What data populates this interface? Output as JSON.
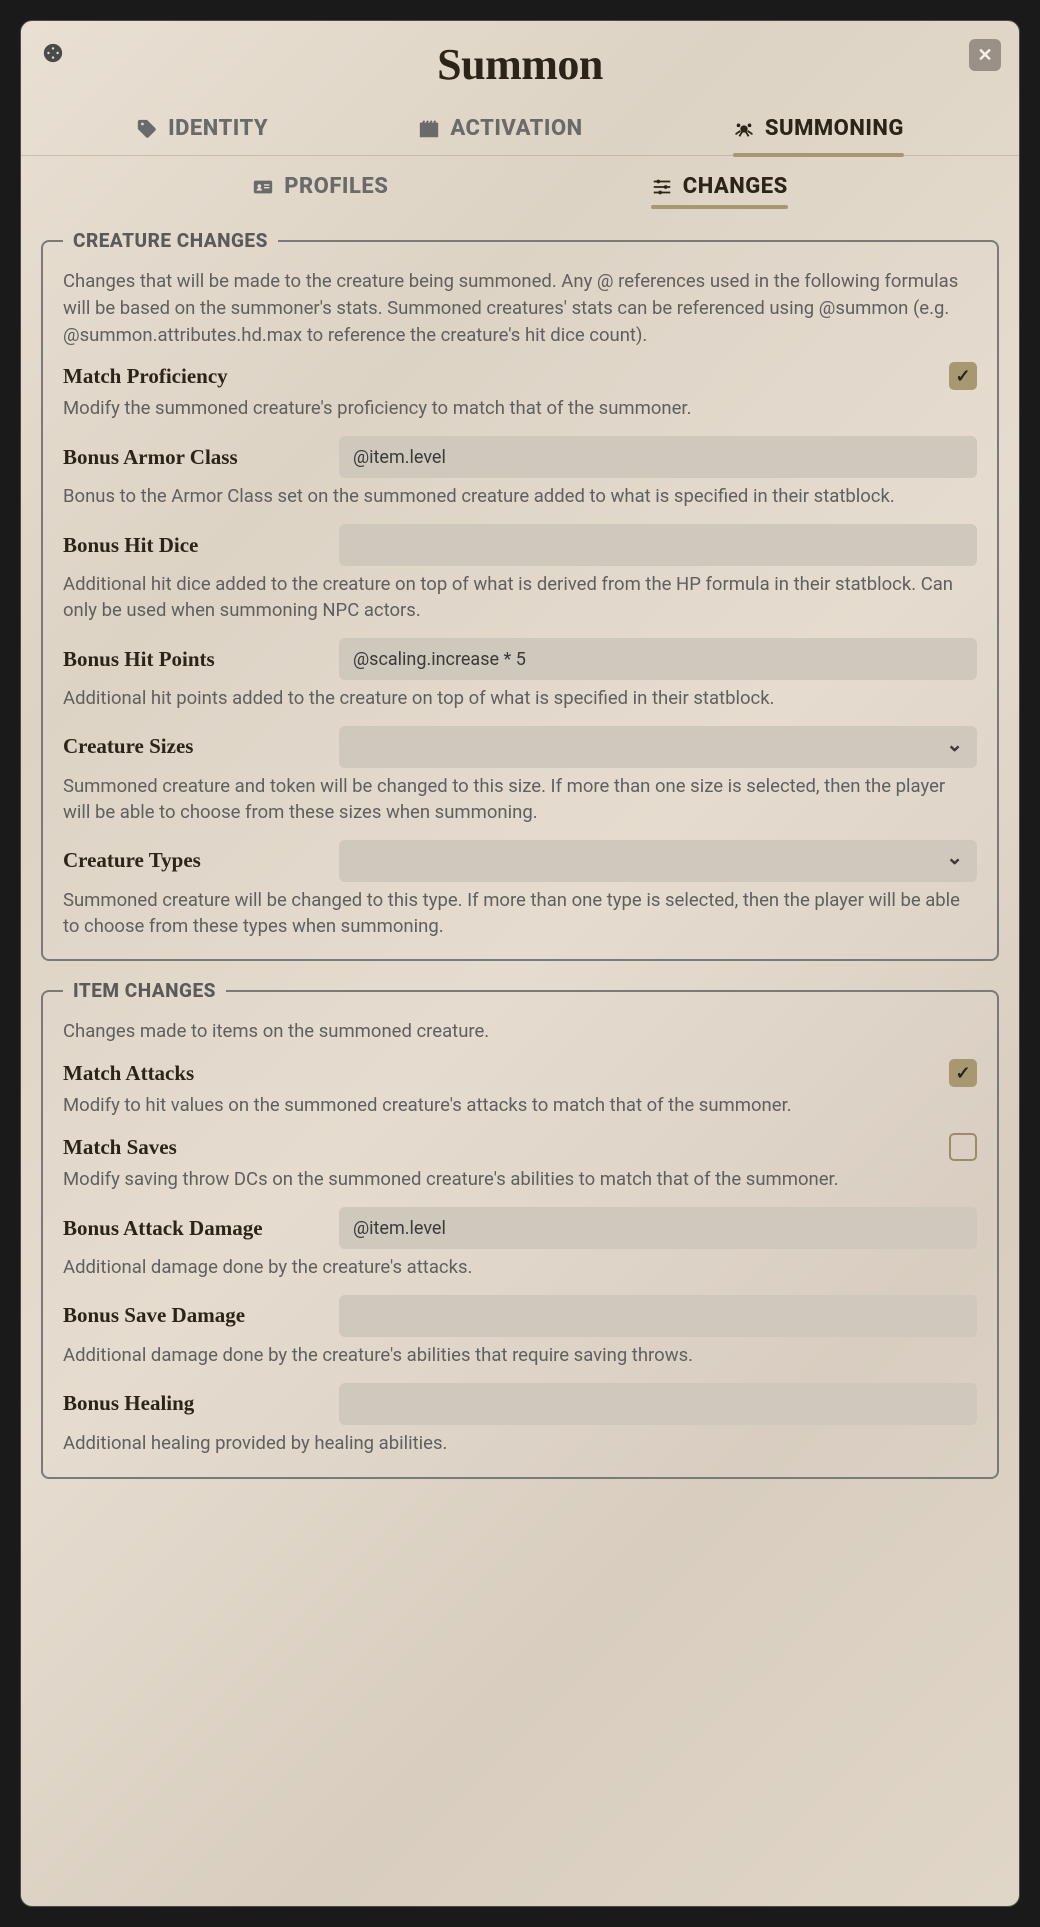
{
  "window": {
    "title": "Summon"
  },
  "tabs_primary": {
    "identity": "IDENTITY",
    "activation": "ACTIVATION",
    "summoning": "SUMMONING"
  },
  "tabs_secondary": {
    "profiles": "PROFILES",
    "changes": "CHANGES"
  },
  "creature": {
    "legend": "CREATURE CHANGES",
    "desc": "Changes that will be made to the creature being summoned. Any @ references used in the following formulas will be based on the summoner's stats. Summoned creatures' stats can be referenced using @summon (e.g. @summon.attributes.hd.max to reference the creature's hit dice count).",
    "match_proficiency": {
      "label": "Match Proficiency",
      "hint": "Modify the summoned creature's proficiency to match that of the summoner.",
      "checked": true
    },
    "bonus_ac": {
      "label": "Bonus Armor Class",
      "value": "@item.level",
      "hint": "Bonus to the Armor Class set on the summoned creature added to what is specified in their statblock."
    },
    "bonus_hd": {
      "label": "Bonus Hit Dice",
      "value": "",
      "hint": "Additional hit dice added to the creature on top of what is derived from the HP formula in their statblock. Can only be used when summoning NPC actors."
    },
    "bonus_hp": {
      "label": "Bonus Hit Points",
      "value": "@scaling.increase * 5",
      "hint": "Additional hit points added to the creature on top of what is specified in their statblock."
    },
    "sizes": {
      "label": "Creature Sizes",
      "hint": "Summoned creature and token will be changed to this size. If more than one size is selected, then the player will be able to choose from these sizes when summoning."
    },
    "types": {
      "label": "Creature Types",
      "hint": "Summoned creature will be changed to this type. If more than one type is selected, then the player will be able to choose from these types when summoning."
    }
  },
  "item": {
    "legend": "ITEM CHANGES",
    "desc": "Changes made to items on the summoned creature.",
    "match_attacks": {
      "label": "Match Attacks",
      "hint": "Modify to hit values on the summoned creature's attacks to match that of the summoner.",
      "checked": true
    },
    "match_saves": {
      "label": "Match Saves",
      "hint": "Modify saving throw DCs on the summoned creature's abilities to match that of the summoner.",
      "checked": false
    },
    "bonus_attack_dmg": {
      "label": "Bonus Attack Damage",
      "value": "@item.level",
      "hint": "Additional damage done by the creature's attacks."
    },
    "bonus_save_dmg": {
      "label": "Bonus Save Damage",
      "value": "",
      "hint": "Additional damage done by the creature's abilities that require saving throws."
    },
    "bonus_healing": {
      "label": "Bonus Healing",
      "value": "",
      "hint": "Additional healing provided by healing abilities."
    }
  }
}
